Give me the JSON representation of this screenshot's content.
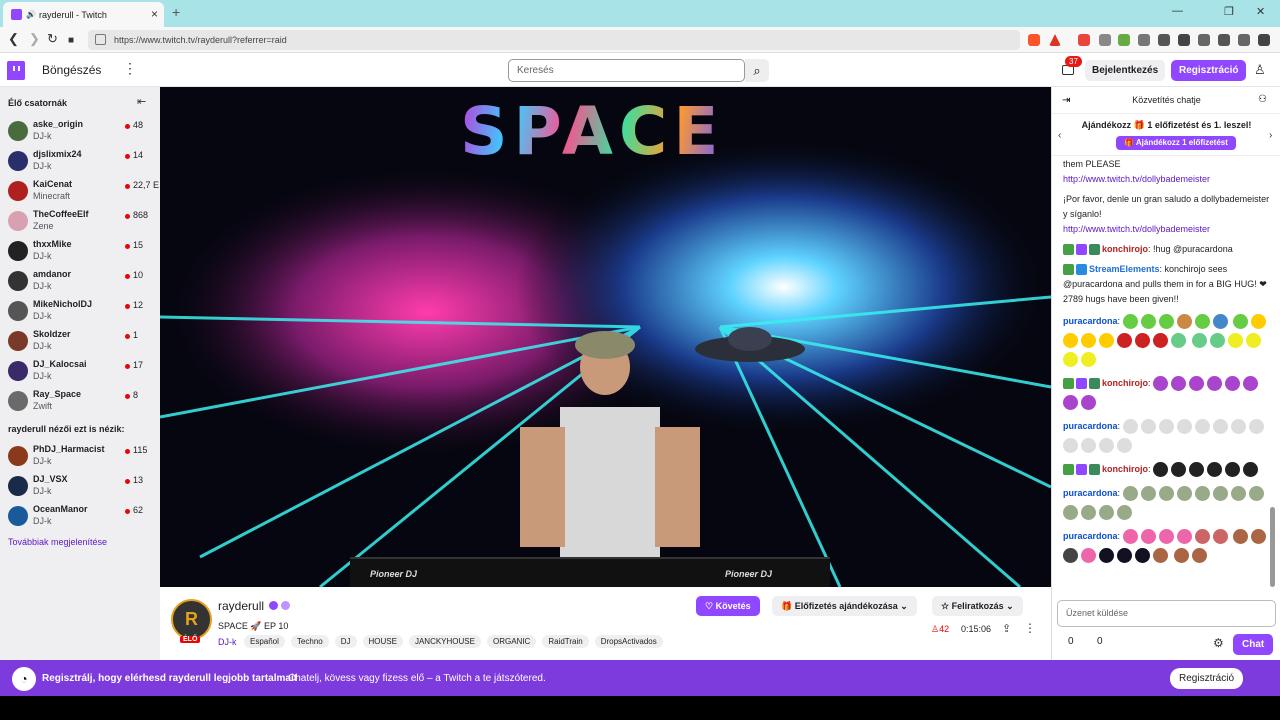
{
  "browser": {
    "tab_title": "rayderull - Twitch",
    "tab_close": "×",
    "new_tab": "+",
    "url": "https://www.twitch.tv/rayderull?referrer=raid",
    "controls": {
      "minimize": "—",
      "maximize": "❐",
      "close": "✕"
    },
    "nav": {
      "back": "❮",
      "forward": "❯",
      "reload": "↻",
      "bookmark": "■"
    }
  },
  "header": {
    "browse": "Böngészés",
    "more": "⋮",
    "search_placeholder": "Keresés",
    "search_icon": "⌕",
    "notif_count": "37",
    "login": "Bejelentkezés",
    "signup": "Regisztráció",
    "user_icon": "♙"
  },
  "sidebar": {
    "title": "Élő csatornák",
    "collapse_icon": "⇤",
    "channels": [
      {
        "name": "aske_origin",
        "category": "DJ-k",
        "viewers": "48",
        "color": "#4a6b3d"
      },
      {
        "name": "djslixmix24",
        "category": "DJ-k",
        "viewers": "14",
        "color": "#2a2f6b"
      },
      {
        "name": "KaiCenat",
        "category": "Minecraft",
        "viewers": "22,7 E",
        "color": "#b02020"
      },
      {
        "name": "TheCoffeeElf",
        "category": "Zene",
        "viewers": "868",
        "color": "#d8a0b0"
      },
      {
        "name": "thxxMike",
        "category": "DJ-k",
        "viewers": "15",
        "color": "#222222"
      },
      {
        "name": "amdanor",
        "category": "DJ-k",
        "viewers": "10",
        "color": "#333333"
      },
      {
        "name": "MikeNicholDJ",
        "category": "DJ-k",
        "viewers": "12",
        "color": "#555555"
      },
      {
        "name": "Skoldzer",
        "category": "DJ-k",
        "viewers": "1",
        "color": "#7a3a2a"
      },
      {
        "name": "DJ_Kalocsai",
        "category": "DJ-k",
        "viewers": "17",
        "color": "#3a2a6a"
      },
      {
        "name": "Ray_Space",
        "category": "Zwift",
        "viewers": "8",
        "color": "#6a6a6a"
      }
    ],
    "recommended_title": "rayderull nézői ezt is nézik:",
    "recommended": [
      {
        "name": "PhDJ_Harmacist",
        "category": "DJ-k",
        "viewers": "115",
        "color": "#8a3a1a"
      },
      {
        "name": "DJ_VSX",
        "category": "DJ-k",
        "viewers": "13",
        "color": "#1a2a4a"
      },
      {
        "name": "OceanManor",
        "category": "DJ-k",
        "viewers": "62",
        "color": "#1a5a9a"
      }
    ],
    "show_more": "Továbbiak megjelenítése"
  },
  "video": {
    "overlay_title": "SPACE",
    "deck_left": "Pioneer DJ",
    "deck_right": "Pioneer DJ"
  },
  "stream": {
    "avatar_letter": "R",
    "live": "ÉLŐ",
    "streamer": "rayderull",
    "title": "SPACE 🚀 EP 10",
    "category": "DJ-k",
    "tags": [
      "Español",
      "Techno",
      "DJ",
      "HOUSE",
      "JANCKYHOUSE",
      "ORGANIC",
      "RaidTrain",
      "DropsActivados"
    ],
    "follow": "♡ Követés",
    "gift_sub": "🎁 Előfizetés ajándékozása ⌄",
    "subscribe": "☆ Feliratkozás ⌄",
    "viewers": "♙42",
    "uptime": "0:15:06",
    "share_icon": "⇪",
    "more_icon": "⋮"
  },
  "chat": {
    "title": "Közvetítés chatje",
    "collapse_icon": "⇥",
    "users_icon": "⚇",
    "gift_banner": "Ajándékozz 🎁 1 előfizetést és 1. leszel!",
    "gift_button": "🎁 Ajándékozz 1 előfizetést",
    "arrow_left": "‹",
    "arrow_right": "›",
    "m1_text": "them PLEASE",
    "m1_link": "http://www.twitch.tv/dollybademeister",
    "m2_text": "¡Por favor, denle un gran saludo a dollybademeister y síganlo!",
    "m2_link": "http://www.twitch.tv/dollybademeister",
    "m3_user": "konchirojo",
    "m3_text": ": !hug @puracardona",
    "m4_user": "StreamElements",
    "m4_text": ": konchirojo sees @puracardona and pulls them in for a BIG HUG! ❤ 2789 hugs have been given!!",
    "m5_user": "puracardona",
    "m6_user": "konchirojo",
    "m7_user": "puracardona",
    "m8_user": "konchirojo",
    "m9_user": "puracardona",
    "m10_user": "puracardona",
    "colon": ":",
    "input_placeholder": "Üzenet küldése",
    "points1": "0",
    "points2": "0",
    "settings_icon": "⚙",
    "chat_button": "Chat"
  },
  "banner": {
    "bold": "Regisztrálj, hogy elérhesd rayderull legjobb tartalmait",
    "text": "Chatelj, kövess vagy fizess elő – a Twitch a te játszótered.",
    "button": "Regisztráció"
  }
}
